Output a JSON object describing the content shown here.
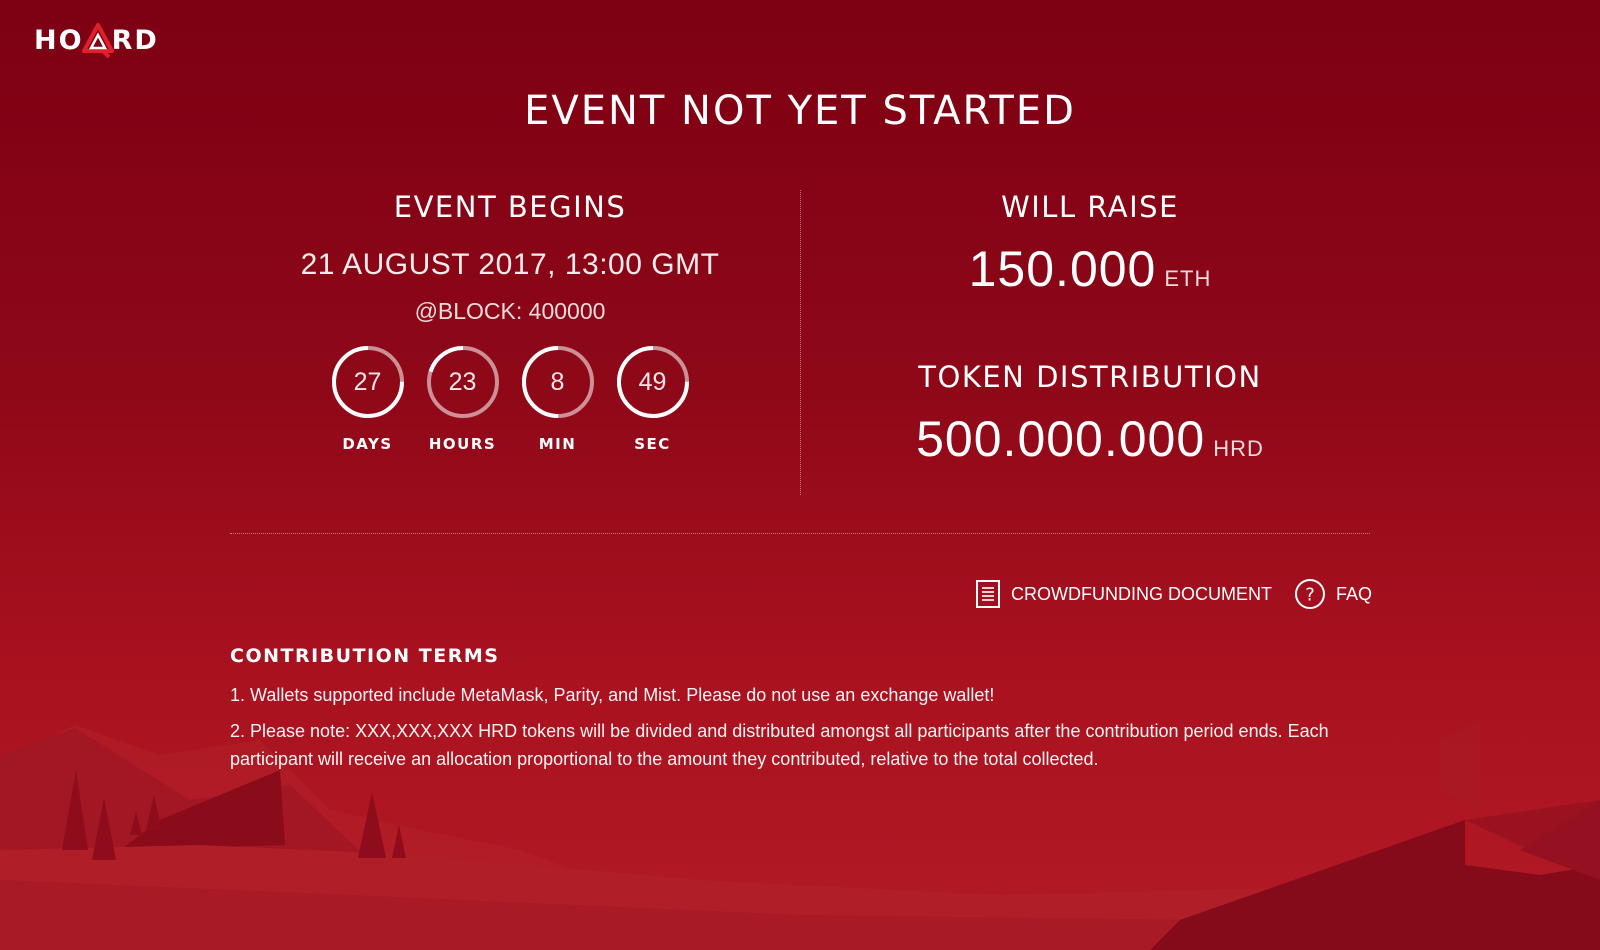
{
  "logo": {
    "text_before": "HO",
    "text_after": "RD",
    "alt": "HOARD"
  },
  "page_title": "EVENT NOT YET STARTED",
  "event": {
    "heading": "EVENT BEGINS",
    "date": "21 AUGUST 2017, 13:00 GMT",
    "block": "@BLOCK: 400000",
    "countdown": [
      {
        "value": "27",
        "label": "DAYS",
        "progress": 0.75
      },
      {
        "value": "23",
        "label": "HOURS",
        "progress": 0.2
      },
      {
        "value": "8",
        "label": "MIN",
        "progress": 0.5
      },
      {
        "value": "49",
        "label": "SEC",
        "progress": 0.75
      }
    ]
  },
  "raise": {
    "heading": "WILL RAISE",
    "amount": "150.000",
    "unit": "ETH"
  },
  "token": {
    "heading": "TOKEN DISTRIBUTION",
    "amount": "500.000.000",
    "unit": "HRD"
  },
  "links": {
    "document": {
      "label": "CROWDFUNDING DOCUMENT",
      "icon": "document-icon"
    },
    "faq": {
      "label": "FAQ",
      "icon": "question-circle-icon"
    }
  },
  "terms": {
    "title": "CONTRIBUTION TERMS",
    "items": [
      "1. Wallets supported include MetaMask, Parity, and Mist. Please do not use an exchange wallet!",
      "2. Please note: XXX,XXX,XXX HRD tokens will be divided and distributed amongst all participants after the contribution period ends. Each participant will receive an allocation proportional to the amount they contributed, relative to the total collected."
    ]
  },
  "colors": {
    "background_top": "#7d0013",
    "background_bottom": "#b21a25",
    "accent": "#e21f2b",
    "ring_track": "rgba(255,255,255,0.55)",
    "text": "#ffffff"
  }
}
